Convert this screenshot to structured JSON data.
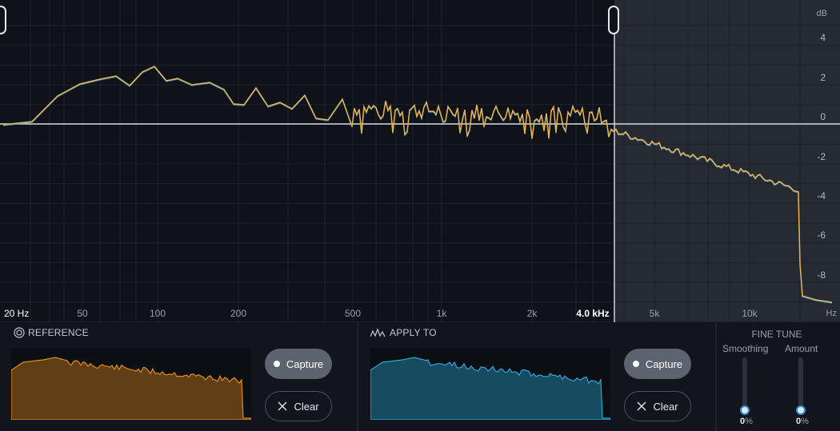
{
  "graph": {
    "db_unit": "dB",
    "hz_unit": "Hz",
    "db_ticks": [
      "4",
      "2",
      "0",
      "-2",
      "-4",
      "-6",
      "-8"
    ],
    "freq_labels": [
      "20 Hz",
      "50",
      "100",
      "200",
      "500",
      "1k",
      "2k",
      "4.0 kHz",
      "5k",
      "10k"
    ],
    "crossover_label": "4.0 kHz",
    "colors": {
      "curve": "#e7b24c",
      "apply_curve": "#3ba6d9",
      "zero_line": "#d9dde2",
      "shade": "#262b33"
    }
  },
  "reference": {
    "title": "REFERENCE",
    "capture_label": "Capture",
    "clear_label": "Clear",
    "color": "#e08a1e"
  },
  "apply_to": {
    "title": "APPLY TO",
    "capture_label": "Capture",
    "clear_label": "Clear",
    "color": "#2aa7d8"
  },
  "fine_tune": {
    "title": "FINE TUNE",
    "smoothing": {
      "label": "Smoothing",
      "value": "0",
      "unit": "%"
    },
    "amount": {
      "label": "Amount",
      "value": "0",
      "unit": "%"
    }
  }
}
